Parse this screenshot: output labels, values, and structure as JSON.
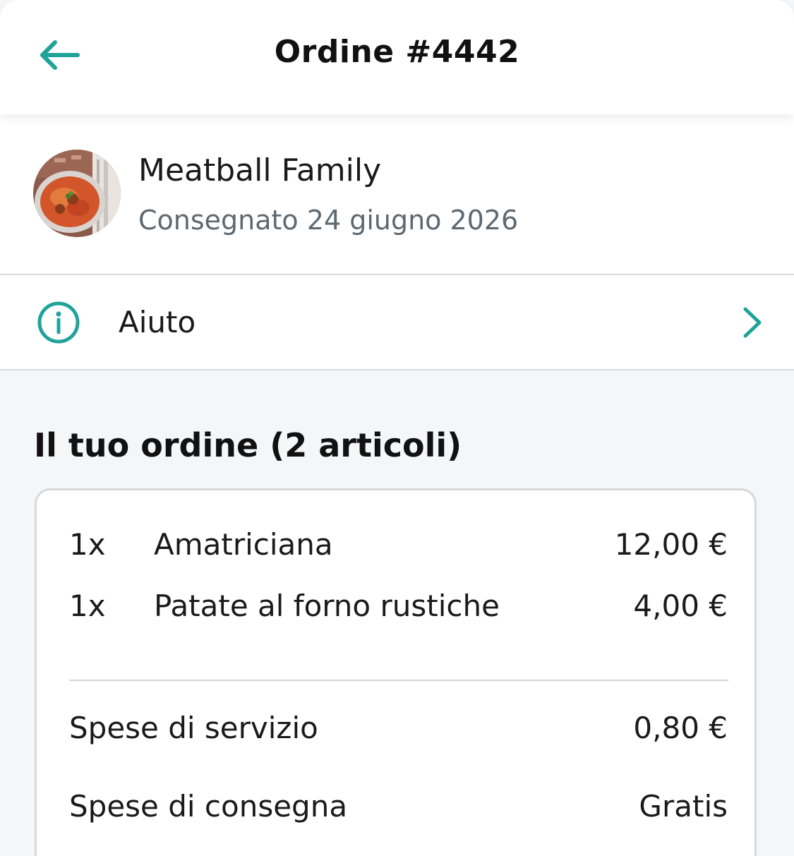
{
  "header": {
    "title": "Ordine #4442",
    "back_icon": "arrow-left-icon"
  },
  "restaurant": {
    "name": "Meatball Family",
    "status": "Consegnato 24 giugno 2026",
    "avatar_icon": "restaurant-avatar"
  },
  "help": {
    "label": "Aiuto",
    "icon": "info-icon",
    "chevron_icon": "chevron-right-icon"
  },
  "order": {
    "title": "Il tuo ordine (2 articoli)",
    "items": [
      {
        "qty": "1x",
        "name": "Amatriciana",
        "price": "12,00 €"
      },
      {
        "qty": "1x",
        "name": "Patate al forno rustiche",
        "price": "4,00 €"
      }
    ],
    "fees": [
      {
        "label": "Spese di servizio",
        "value": "0,80 €"
      },
      {
        "label": "Spese di consegna",
        "value": "Gratis"
      }
    ]
  },
  "colors": {
    "accent": "#1fa39a",
    "background": "#f5f6f8",
    "muted_text": "#5d6870"
  }
}
